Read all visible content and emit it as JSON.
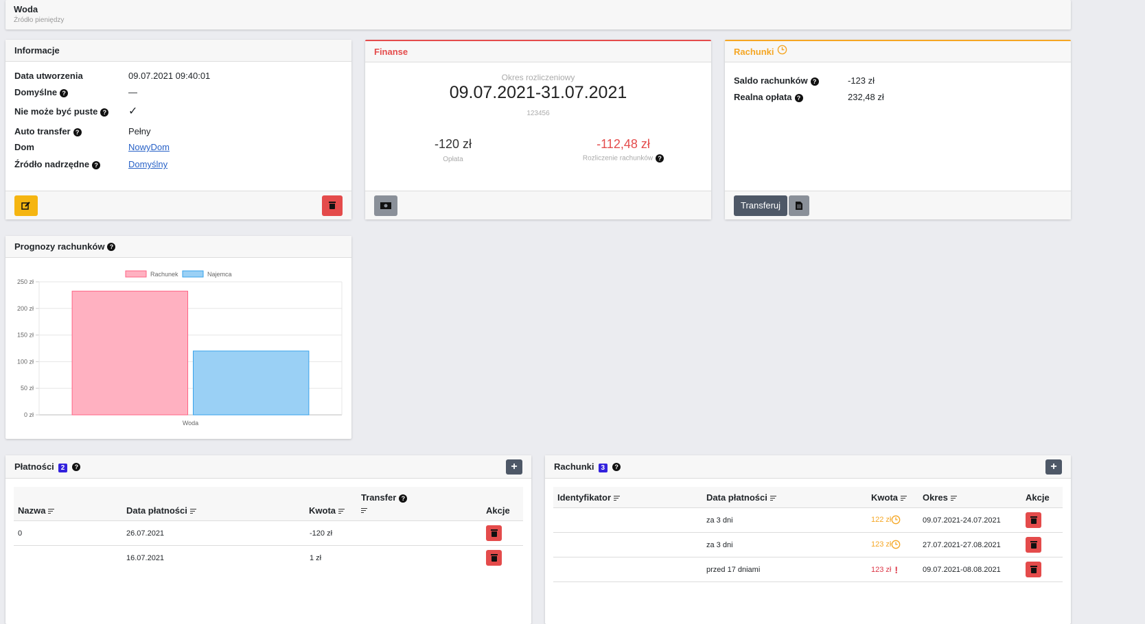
{
  "page": {
    "title": "Woda",
    "subtitle": "Źródło pieniędzy"
  },
  "info": {
    "header": "Informacje",
    "rows": [
      {
        "label": "Data utworzenia",
        "value": "09.07.2021 09:40:01"
      },
      {
        "label": "Domyślne",
        "value": "—"
      },
      {
        "label": "Nie może być puste",
        "value": "✓"
      },
      {
        "label": "Auto transfer",
        "value": "Pełny"
      },
      {
        "label": "Dom",
        "value": "NowyDom"
      },
      {
        "label": "Źródło nadrzędne",
        "value": "Domyślny"
      }
    ]
  },
  "finanse": {
    "header": "Finanse",
    "period_label": "Okres rozliczeniowy",
    "period": "09.07.2021-31.07.2021",
    "code": "123456",
    "fee_value": "-120 zł",
    "fee_label": "Opłata",
    "settlement_value": "-112,48 zł",
    "settlement_label": "Rozliczenie rachunków"
  },
  "rachunki_summary": {
    "header": "Rachunki",
    "rows": [
      {
        "label": "Saldo rachunków",
        "value": "-123 zł"
      },
      {
        "label": "Realna opłata",
        "value": "232,48 zł"
      }
    ],
    "transfer_button": "Transferuj"
  },
  "forecast": {
    "header": "Prognozy rachunków"
  },
  "chart_data": {
    "type": "bar",
    "categories": [
      "Woda"
    ],
    "series": [
      {
        "name": "Rachunek",
        "values": [
          232.48
        ],
        "color": "#ffb1c1"
      },
      {
        "name": "Najemca",
        "values": [
          120
        ],
        "color": "#9ad0f5"
      }
    ],
    "ylim": [
      0,
      250
    ],
    "yticks": [
      "0 zł",
      "50 zł",
      "100 zł",
      "150 zł",
      "200 zł",
      "250 zł"
    ],
    "legend": "top",
    "grid": true
  },
  "payments": {
    "header": "Płatności",
    "count": "2",
    "columns": [
      "Nazwa",
      "Data płatności",
      "Kwota",
      "Transfer",
      "Akcje"
    ],
    "rows": [
      {
        "name": "0",
        "date": "26.07.2021",
        "amount": "-120 zł",
        "transfer": ""
      },
      {
        "name": "",
        "date": "16.07.2021",
        "amount": "1 zł",
        "transfer": ""
      }
    ]
  },
  "bills": {
    "header": "Rachunki",
    "count": "3",
    "columns": [
      "Identyfikator",
      "Data płatności",
      "Kwota",
      "Okres",
      "Akcje"
    ],
    "rows": [
      {
        "id": "",
        "due": "za 3 dni",
        "amount": "122 zł",
        "status": "pending",
        "period": "09.07.2021-24.07.2021"
      },
      {
        "id": "",
        "due": "za 3 dni",
        "amount": "123 zł",
        "status": "pending",
        "period": "27.07.2021-27.08.2021"
      },
      {
        "id": "",
        "due": "przed 17 dniami",
        "amount": "123 zł",
        "status": "overdue",
        "period": "09.07.2021-08.08.2021"
      }
    ]
  },
  "colors": {
    "warning": "#f5b511",
    "danger": "#e44b4b",
    "orange": "#f5a623",
    "red": "#dc3545",
    "badge": "#3322dd"
  }
}
